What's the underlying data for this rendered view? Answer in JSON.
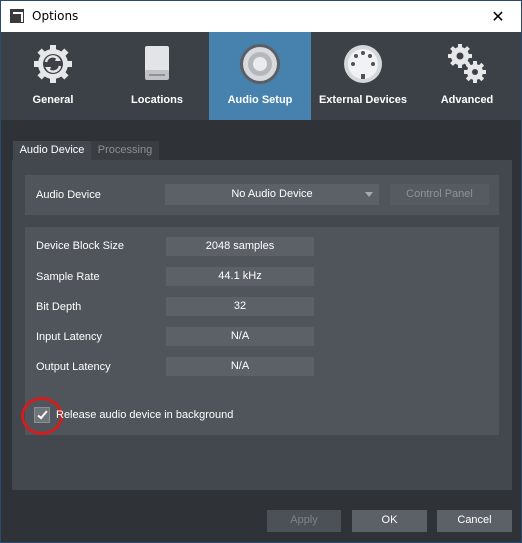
{
  "window": {
    "title": "Options",
    "close_glyph": "✕"
  },
  "nav": {
    "items": [
      {
        "label": "General",
        "icon": "sync-gear-icon"
      },
      {
        "label": "Locations",
        "icon": "drive-icon"
      },
      {
        "label": "Audio Setup",
        "icon": "speaker-icon",
        "active": true
      },
      {
        "label": "External Devices",
        "icon": "midi-port-icon"
      },
      {
        "label": "Advanced",
        "icon": "gears-icon"
      }
    ]
  },
  "tabs": [
    {
      "label": "Audio Device",
      "active": true
    },
    {
      "label": "Processing",
      "active": false
    }
  ],
  "audio_device": {
    "label": "Audio Device",
    "selected": "No Audio Device",
    "control_panel_label": "Control Panel"
  },
  "settings": {
    "block_size": {
      "label": "Device Block Size",
      "value": "2048 samples"
    },
    "sample_rate": {
      "label": "Sample Rate",
      "value": "44.1 kHz"
    },
    "bit_depth": {
      "label": "Bit Depth",
      "value": "32"
    },
    "input_latency": {
      "label": "Input Latency",
      "value": "N/A"
    },
    "output_latency": {
      "label": "Output Latency",
      "value": "N/A"
    }
  },
  "release_checkbox": {
    "label": "Release audio device in background",
    "checked": true
  },
  "buttons": {
    "apply": "Apply",
    "ok": "OK",
    "cancel": "Cancel"
  },
  "colors": {
    "accent": "#4682ad",
    "highlight": "#d11d1d",
    "background": "#2f3338"
  }
}
